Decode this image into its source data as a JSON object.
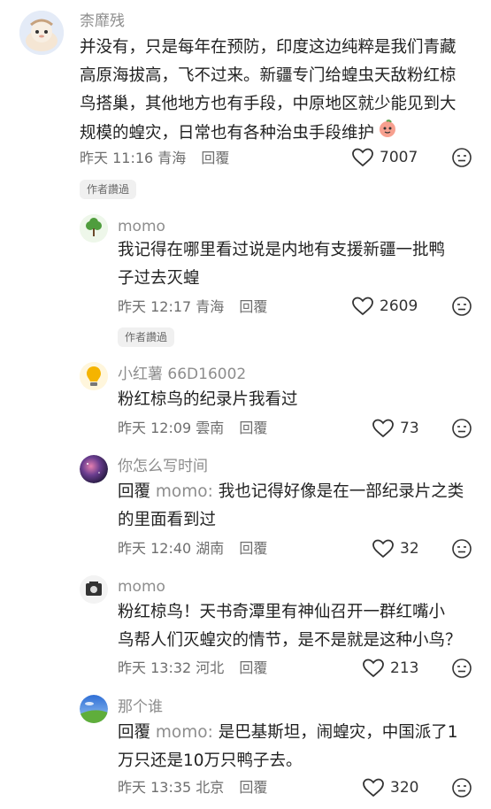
{
  "comments": [
    {
      "user": "柰靡残",
      "lines": [
        "并没有，只是每年在预防，印度这边纯粹是我们青藏",
        "高原海拔高，飞不过来。新疆专门给蝗虫天敌粉红椋",
        "鸟搭巢，其他地方也有手段，中原地区就少能见到大",
        "规模的蝗灾，日常也有各种治虫手段维护"
      ],
      "time": "昨天 11:16 青海",
      "reply_label": "回覆",
      "likes": "7007",
      "tag": "作者讚過"
    },
    {
      "user": "momo",
      "lines": [
        "我记得在哪里看过说是内地有支援新疆一批鸭",
        "子过去灭蝗"
      ],
      "time": "昨天 12:17 青海",
      "reply_label": "回覆",
      "likes": "2609",
      "tag": "作者讚過"
    },
    {
      "user": "小红薯 66D16002",
      "lines": [
        "粉红椋鸟的纪录片我看过"
      ],
      "time": "昨天 12:09 雲南",
      "reply_label": "回覆",
      "likes": "73"
    },
    {
      "user": "你怎么写时间",
      "reply_prefix": "回覆",
      "reply_target": "momo:",
      "lines": [
        "我也记得好像是在一部纪录片之类",
        "的里面看到过"
      ],
      "time": "昨天 12:40 湖南",
      "reply_label": "回覆",
      "likes": "32"
    },
    {
      "user": "momo",
      "lines": [
        "粉红椋鸟！天书奇潭里有神仙召开一群红嘴小",
        "鸟帮人们灭蝗灾的情节，是不是就是这种小鸟？"
      ],
      "time": "昨天 13:32 河北",
      "reply_label": "回覆",
      "likes": "213"
    },
    {
      "user": "那个谁",
      "reply_prefix": "回覆",
      "reply_target": "momo:",
      "lines": [
        "是巴基斯坦，闹蝗灾，中国派了1",
        "万只还是10万只鸭子去。"
      ],
      "time": "昨天 13:35 北京",
      "reply_label": "回覆",
      "likes": "320"
    }
  ],
  "colors": {
    "meta_gray": "#8d8d8d",
    "tag_bg": "#f0f0f0"
  }
}
